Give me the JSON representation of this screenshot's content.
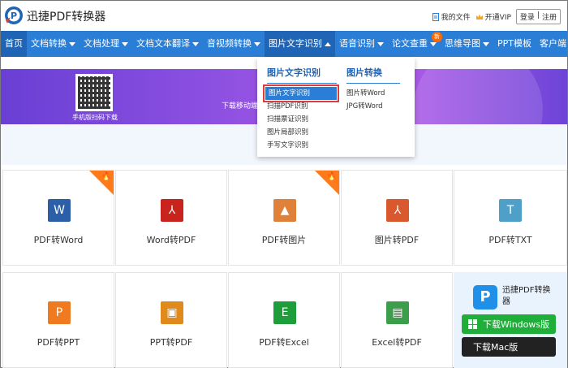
{
  "header": {
    "app_title": "迅捷PDF转换器",
    "my_files": "我的文件",
    "open_vip": "开通VIP",
    "login": "登录",
    "separator": "|",
    "register": "注册"
  },
  "nav": {
    "items": [
      {
        "label": "首页"
      },
      {
        "label": "文档转换"
      },
      {
        "label": "文档处理"
      },
      {
        "label": "文档文本翻译"
      },
      {
        "label": "音视频转换"
      },
      {
        "label": "图片文字识别"
      },
      {
        "label": "语音识别"
      },
      {
        "label": "论文查重"
      },
      {
        "label": "思维导图"
      },
      {
        "label": "PPT模板"
      },
      {
        "label": "客户端"
      }
    ],
    "new_badge": "新"
  },
  "banner": {
    "qr_caption": "手机版扫码下载",
    "text": "下载移动端"
  },
  "dropdown": {
    "col1": {
      "heading": "图片文字识别",
      "items": [
        "图片文字识别",
        "扫描PDF识别",
        "扫描票证识别",
        "图片局部识别",
        "手写文字识别"
      ]
    },
    "col2": {
      "heading": "图片转换",
      "items": [
        "图片转Word",
        "JPG转Word"
      ]
    }
  },
  "tools": {
    "row1": [
      {
        "label": "PDF转Word",
        "icon": "word-icon",
        "glyph": "W",
        "color": "#2b5fa8"
      },
      {
        "label": "Word转PDF",
        "icon": "pdf-icon",
        "glyph": "⅄",
        "color": "#c8231c"
      },
      {
        "label": "PDF转图片",
        "icon": "image-icon",
        "glyph": "▲",
        "color": "#e0813a"
      },
      {
        "label": "图片转PDF",
        "icon": "pdf-icon",
        "glyph": "⅄",
        "color": "#d9582e"
      },
      {
        "label": "PDF转TXT",
        "icon": "txt-icon",
        "glyph": "T",
        "color": "#4fa0c8"
      }
    ],
    "row2": [
      {
        "label": "PDF转PPT",
        "icon": "ppt-icon",
        "glyph": "P",
        "color": "#f07a1f"
      },
      {
        "label": "PPT转PDF",
        "icon": "ppt-pdf-icon",
        "glyph": "▣",
        "color": "#e08a1c"
      },
      {
        "label": "PDF转Excel",
        "icon": "excel-icon",
        "glyph": "E",
        "color": "#1e9e3a"
      },
      {
        "label": "Excel转PDF",
        "icon": "excel-pdf-icon",
        "glyph": "▤",
        "color": "#3c9e4a"
      }
    ],
    "hot_flame": "🔥"
  },
  "promo": {
    "logo_glyph": "P",
    "name": "迅捷PDF转换器",
    "win_button": "下载Windows版",
    "mac_button": "下载Mac版",
    "mac_glyph": ""
  }
}
